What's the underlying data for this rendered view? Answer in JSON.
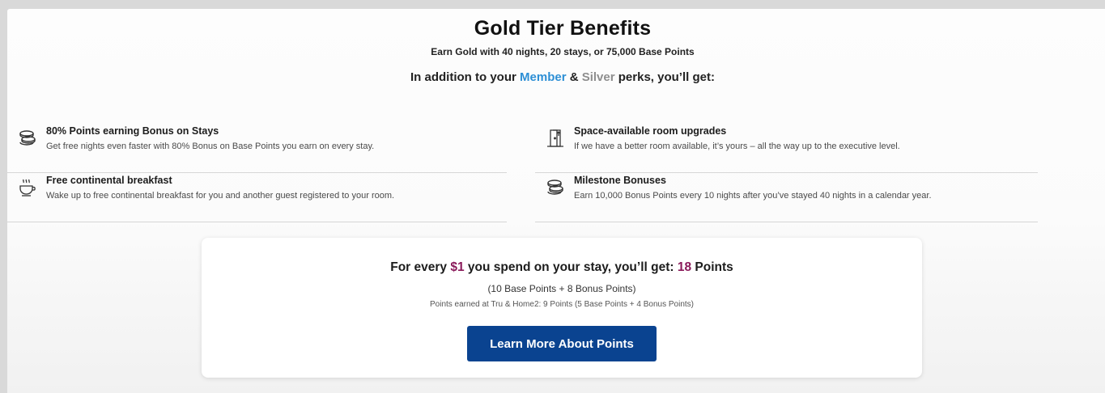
{
  "header": {
    "title": "Gold Tier Benefits",
    "subtitle": "Earn Gold with 40 nights, 20 stays, or 75,000 Base Points",
    "intro_prefix": "In addition to your ",
    "intro_member": "Member",
    "intro_amp": " & ",
    "intro_silver": "Silver",
    "intro_suffix": " perks, you’ll get:"
  },
  "benefits": [
    {
      "icon": "coins-stack-icon",
      "title": "80% Points earning Bonus on Stays",
      "description": "Get free nights even faster with 80% Bonus on Base Points you earn on every stay."
    },
    {
      "icon": "room-upgrade-icon",
      "title": "Space-available room upgrades",
      "description": "If we have a better room available, it’s yours – all the way up to the executive level."
    },
    {
      "icon": "coffee-cup-icon",
      "title": "Free continental breakfast",
      "description": "Wake up to free continental breakfast for you and another guest registered to your room."
    },
    {
      "icon": "coins-stack-icon",
      "title": "Milestone Bonuses",
      "description": "Earn 10,000 Bonus Points every 10 nights after you’ve stayed 40 nights in a calendar year."
    }
  ],
  "points_card": {
    "prefix": "For every ",
    "amount": "$1",
    "middle": " you spend on your stay, you’ll get: ",
    "points_value": "18",
    "points_suffix": " Points",
    "breakdown": "(10 Base Points + 8 Bonus Points)",
    "note": "Points earned at Tru & Home2: 9 Points (5 Base Points + 4 Bonus Points)",
    "button_label": "Learn More About Points"
  },
  "colors": {
    "member": "#2d8fd5",
    "silver": "#8e8e8e",
    "accent": "#8a1a5a",
    "button": "#0a4390"
  }
}
